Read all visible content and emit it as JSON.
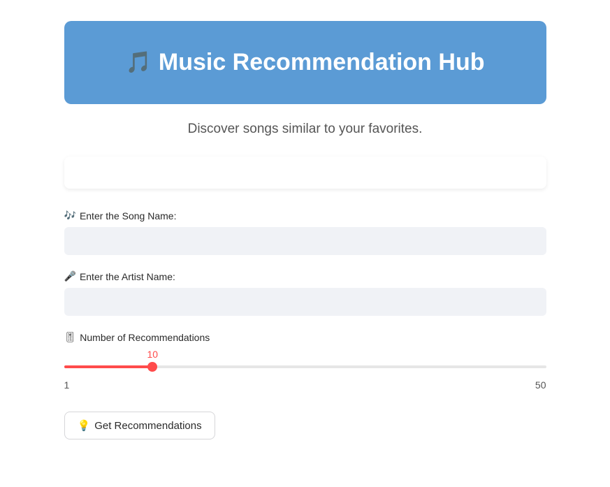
{
  "header": {
    "icon": "🎵",
    "title": "Music Recommendation Hub"
  },
  "subtitle": "Discover songs similar to your favorites.",
  "fields": {
    "song": {
      "icon": "🎶",
      "label": "Enter the Song Name:",
      "value": ""
    },
    "artist": {
      "icon": "🎤",
      "label": "Enter the Artist Name:",
      "value": ""
    }
  },
  "slider": {
    "icon": "🎚",
    "label": "Number of Recommendations",
    "value": "10",
    "min": "1",
    "max": "50",
    "percent": 18.37
  },
  "button": {
    "icon": "💡",
    "label": "Get Recommendations"
  }
}
